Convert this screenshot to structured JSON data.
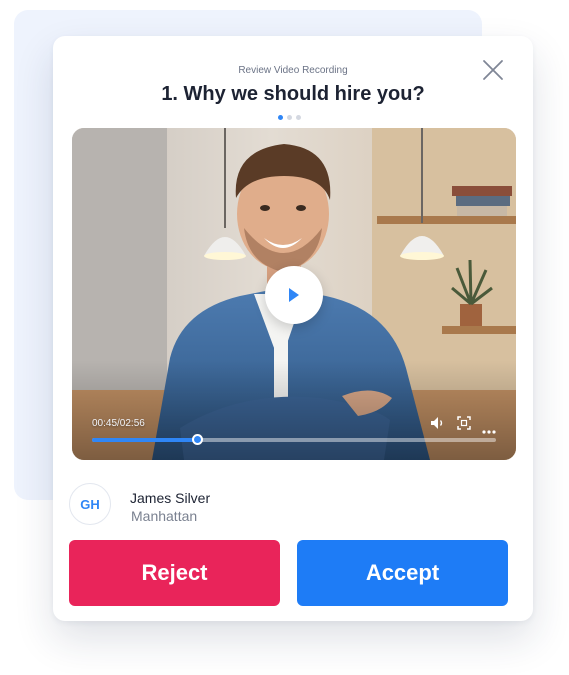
{
  "header": {
    "subtitle": "Review Video Recording",
    "title": "1. Why we should hire you?"
  },
  "icons": {
    "close": "close-icon",
    "play": "play-icon",
    "volume": "volume-icon",
    "fullscreen": "fullscreen-icon",
    "more": "more-options-icon"
  },
  "pagination": {
    "total": 3,
    "active": 1
  },
  "video": {
    "time_display": "00:45/02:56",
    "progress": 0.26
  },
  "candidate": {
    "initials": "GH",
    "name": "James Silver",
    "location": "Manhattan"
  },
  "actions": {
    "reject_label": "Reject",
    "accept_label": "Accept"
  },
  "colors": {
    "accent": "#2f86f6",
    "reject": "#e9245a",
    "accept": "#1e7cf6",
    "back_card": "#eef3fd"
  }
}
